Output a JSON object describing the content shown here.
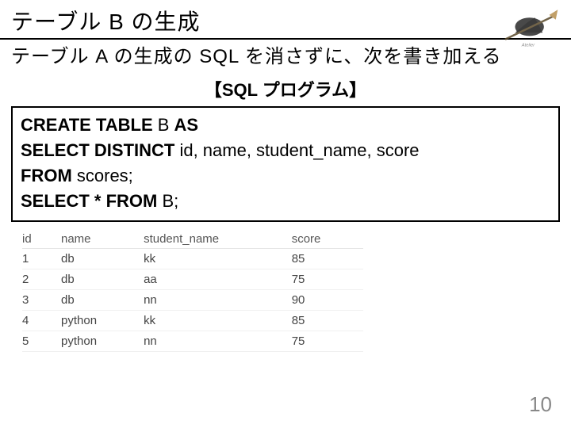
{
  "title": "テーブル B の生成",
  "subtitle": "テーブル A の生成の SQL を消さずに、次を書き加える",
  "program_label": "【SQL プログラム】",
  "code": {
    "l1a": "CREATE TABLE",
    "l1b": " B ",
    "l1c": "AS",
    "l2a": "SELECT DISTINCT",
    "l2b": " id, name, student_name, score",
    "l3a": "FROM",
    "l3b": " scores;",
    "l4a": "SELECT * FROM",
    "l4b": " B;"
  },
  "table": {
    "headers": [
      "id",
      "name",
      "student_name",
      "score"
    ],
    "rows": [
      [
        "1",
        "db",
        "kk",
        "85"
      ],
      [
        "2",
        "db",
        "aa",
        "75"
      ],
      [
        "3",
        "db",
        "nn",
        "90"
      ],
      [
        "4",
        "python",
        "kk",
        "85"
      ],
      [
        "5",
        "python",
        "nn",
        "75"
      ]
    ]
  },
  "page_number": "10"
}
